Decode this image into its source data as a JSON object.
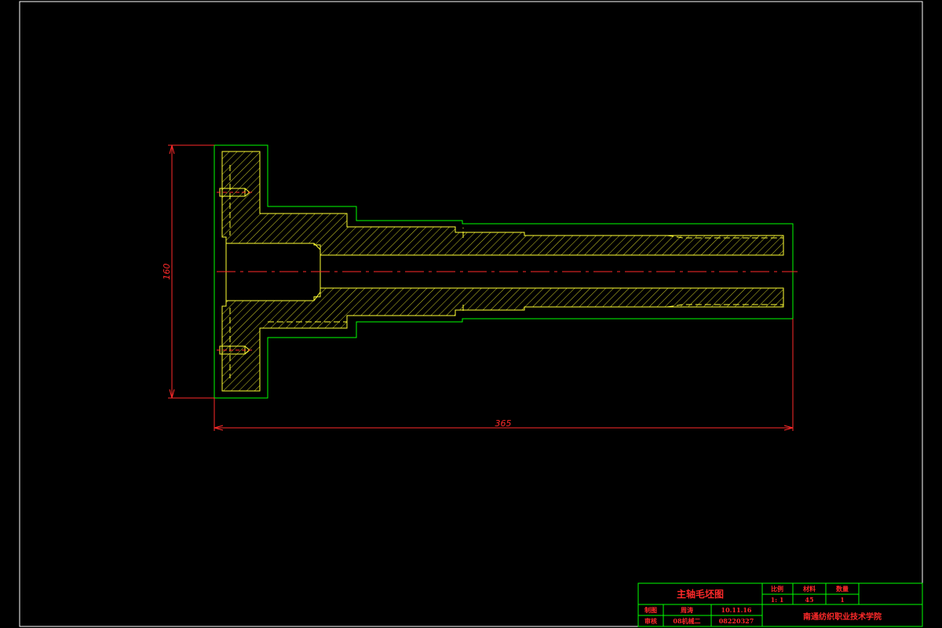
{
  "drawing": {
    "dimensions": {
      "height_label": "160",
      "length_label": "365"
    },
    "title_block": {
      "drawing_title": "主轴毛坯图",
      "headers": {
        "scale": "比例",
        "material": "材料",
        "quantity": "数量"
      },
      "values": {
        "scale": "1: 1",
        "material": "45",
        "quantity": "1"
      },
      "rows": [
        {
          "role": "制图",
          "name": "周涛",
          "info": "10.11.16"
        },
        {
          "role": "审核",
          "name": "08机械二",
          "info": "08220327"
        }
      ],
      "school": "南通纺织职业技术学院"
    },
    "colors": {
      "background": "#000000",
      "border": "#ffffff",
      "outline": "#00ff00",
      "part": "#ffff33",
      "dimension": "#ff2a2a"
    }
  }
}
